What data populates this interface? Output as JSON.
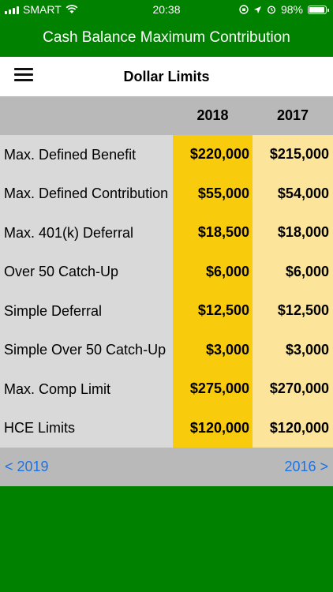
{
  "status": {
    "carrier": "SMART",
    "time": "20:38",
    "battery": "98%",
    "battery_level": 0.98,
    "icons": [
      "signal-icon",
      "wifi-icon",
      "orientation-lock-icon",
      "location-icon",
      "alarm-icon",
      "battery-icon"
    ]
  },
  "app": {
    "title": "Cash Balance Maximum Contribution"
  },
  "nav": {
    "title": "Dollar Limits",
    "menu_icon": "hamburger-menu-icon"
  },
  "table": {
    "columns": [
      "2018",
      "2017"
    ],
    "rows": [
      {
        "label": "Max. Defined Benefit",
        "v2018": "$220,000",
        "v2017": "$215,000"
      },
      {
        "label": "Max. Defined Contribution",
        "v2018": "$55,000",
        "v2017": "$54,000"
      },
      {
        "label": "Max. 401(k) Deferral",
        "v2018": "$18,500",
        "v2017": "$18,000"
      },
      {
        "label": "Over 50 Catch-Up",
        "v2018": "$6,000",
        "v2017": "$6,000"
      },
      {
        "label": "Simple Deferral",
        "v2018": "$12,500",
        "v2017": "$12,500"
      },
      {
        "label": "Simple Over 50 Catch-Up",
        "v2018": "$3,000",
        "v2017": "$3,000"
      },
      {
        "label": "Max. Comp Limit",
        "v2018": "$275,000",
        "v2017": "$270,000"
      },
      {
        "label": "HCE Limits",
        "v2018": "$120,000",
        "v2017": "$120,000"
      }
    ]
  },
  "pager": {
    "prev_label": "< 2019",
    "next_label": "2016 >"
  },
  "colors": {
    "app_green": "#008100",
    "col_2018": "#f8cb0c",
    "col_2017": "#fce49b",
    "link_blue": "#1a73e8"
  }
}
